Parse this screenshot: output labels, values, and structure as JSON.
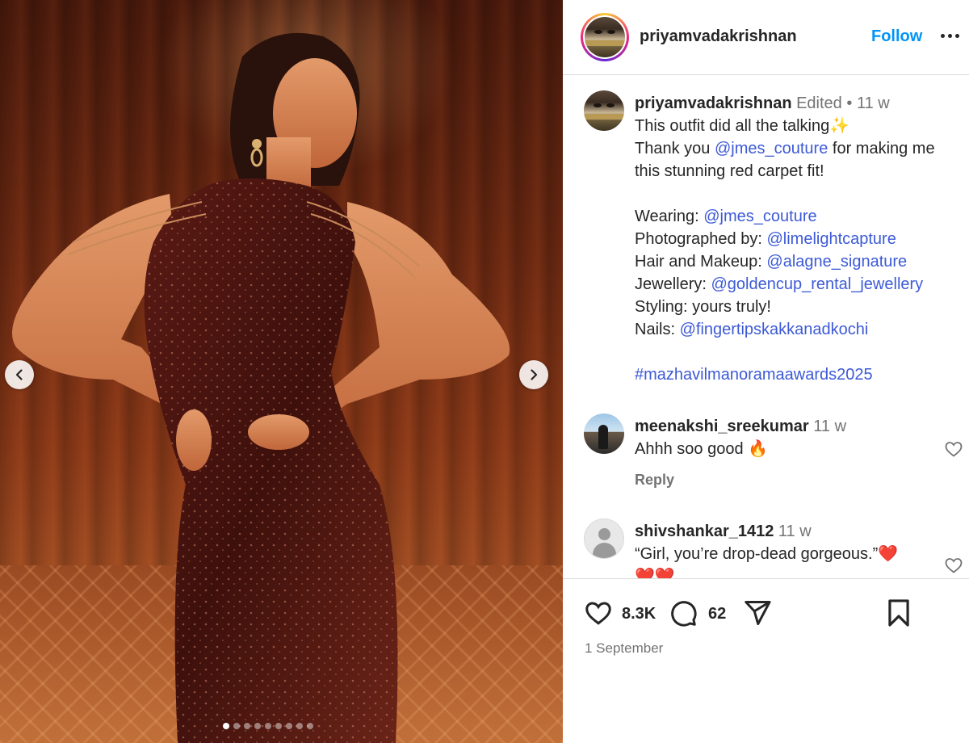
{
  "post": {
    "username": "priyamvadakrishnan",
    "follow_label": "Follow",
    "more_label": "More options",
    "media": {
      "slide_count": 9,
      "active_slide": 1,
      "prev_label": "Previous",
      "next_label": "Next"
    }
  },
  "caption": {
    "username": "priyamvadakrishnan",
    "edited": "Edited",
    "separator": "•",
    "time": "11 w",
    "line1": "This outfit did all the talking",
    "line1_emoji": "✨",
    "line2_pre": "Thank you ",
    "line2_mention": "@jmes_couture",
    "line2_post": " for making me this stunning red carpet fit!",
    "credits": [
      {
        "label": "Wearing: ",
        "mention": "@jmes_couture"
      },
      {
        "label": "Photographed by: ",
        "mention": "@limelightcapture"
      },
      {
        "label": "Hair and Makeup: ",
        "mention": "@alagne_signature"
      },
      {
        "label": "Jewellery: ",
        "mention": "@goldencup_rental_jewellery"
      },
      {
        "label": "Styling: yours truly!",
        "mention": ""
      },
      {
        "label": "Nails: ",
        "mention": "@fingertipskakkanadkochi"
      }
    ],
    "hashtag": "#mazhavilmanoramaawards2025"
  },
  "comments": [
    {
      "username": "meenakshi_sreekumar",
      "time": "11 w",
      "text": "Ahhh soo good ",
      "emoji": "🔥",
      "reply_label": "Reply"
    },
    {
      "username": "shivshankar_1412",
      "time": "11 w",
      "text": "“Girl, you’re drop-dead gorgeous.”",
      "emoji": "❤️",
      "emoji_line2": "❤️❤️"
    }
  ],
  "actions": {
    "likes": "8.3K",
    "comments": "62",
    "date": "1 September"
  },
  "colors": {
    "link": "#3d5ad6",
    "follow": "#0095f6",
    "muted": "#737373",
    "border": "#dbdbdb"
  }
}
